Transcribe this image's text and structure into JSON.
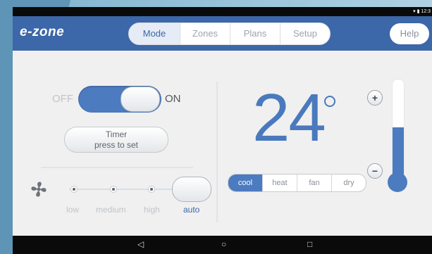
{
  "status_bar": {
    "time": "12:3"
  },
  "app": {
    "logo": "e-zone"
  },
  "tabs": [
    {
      "label": "Mode",
      "active": true
    },
    {
      "label": "Zones",
      "active": false
    },
    {
      "label": "Plans",
      "active": false
    },
    {
      "label": "Setup",
      "active": false
    }
  ],
  "help_label": "Help",
  "power": {
    "off_label": "OFF",
    "on_label": "ON",
    "state": "on"
  },
  "timer": {
    "title": "Timer",
    "subtitle": "press to set"
  },
  "fan": {
    "icon": "fan-icon",
    "speeds": [
      "low",
      "medium",
      "high",
      "auto"
    ],
    "selected": "auto"
  },
  "temperature": {
    "value": "24",
    "unit_icon": "degree-symbol",
    "level": 0.55
  },
  "modes": [
    {
      "label": "cool",
      "active": true
    },
    {
      "label": "heat",
      "active": false
    },
    {
      "label": "fan",
      "active": false
    },
    {
      "label": "dry",
      "active": false
    }
  ],
  "temp_controls": {
    "increase_icon": "plus-icon",
    "decrease_icon": "minus-icon",
    "increase": "+",
    "decrease": "−"
  },
  "navbar": {
    "back": "◁",
    "home": "○",
    "recents": "□"
  },
  "colors": {
    "accent": "#3c67a8",
    "active": "#4c7bbf"
  }
}
